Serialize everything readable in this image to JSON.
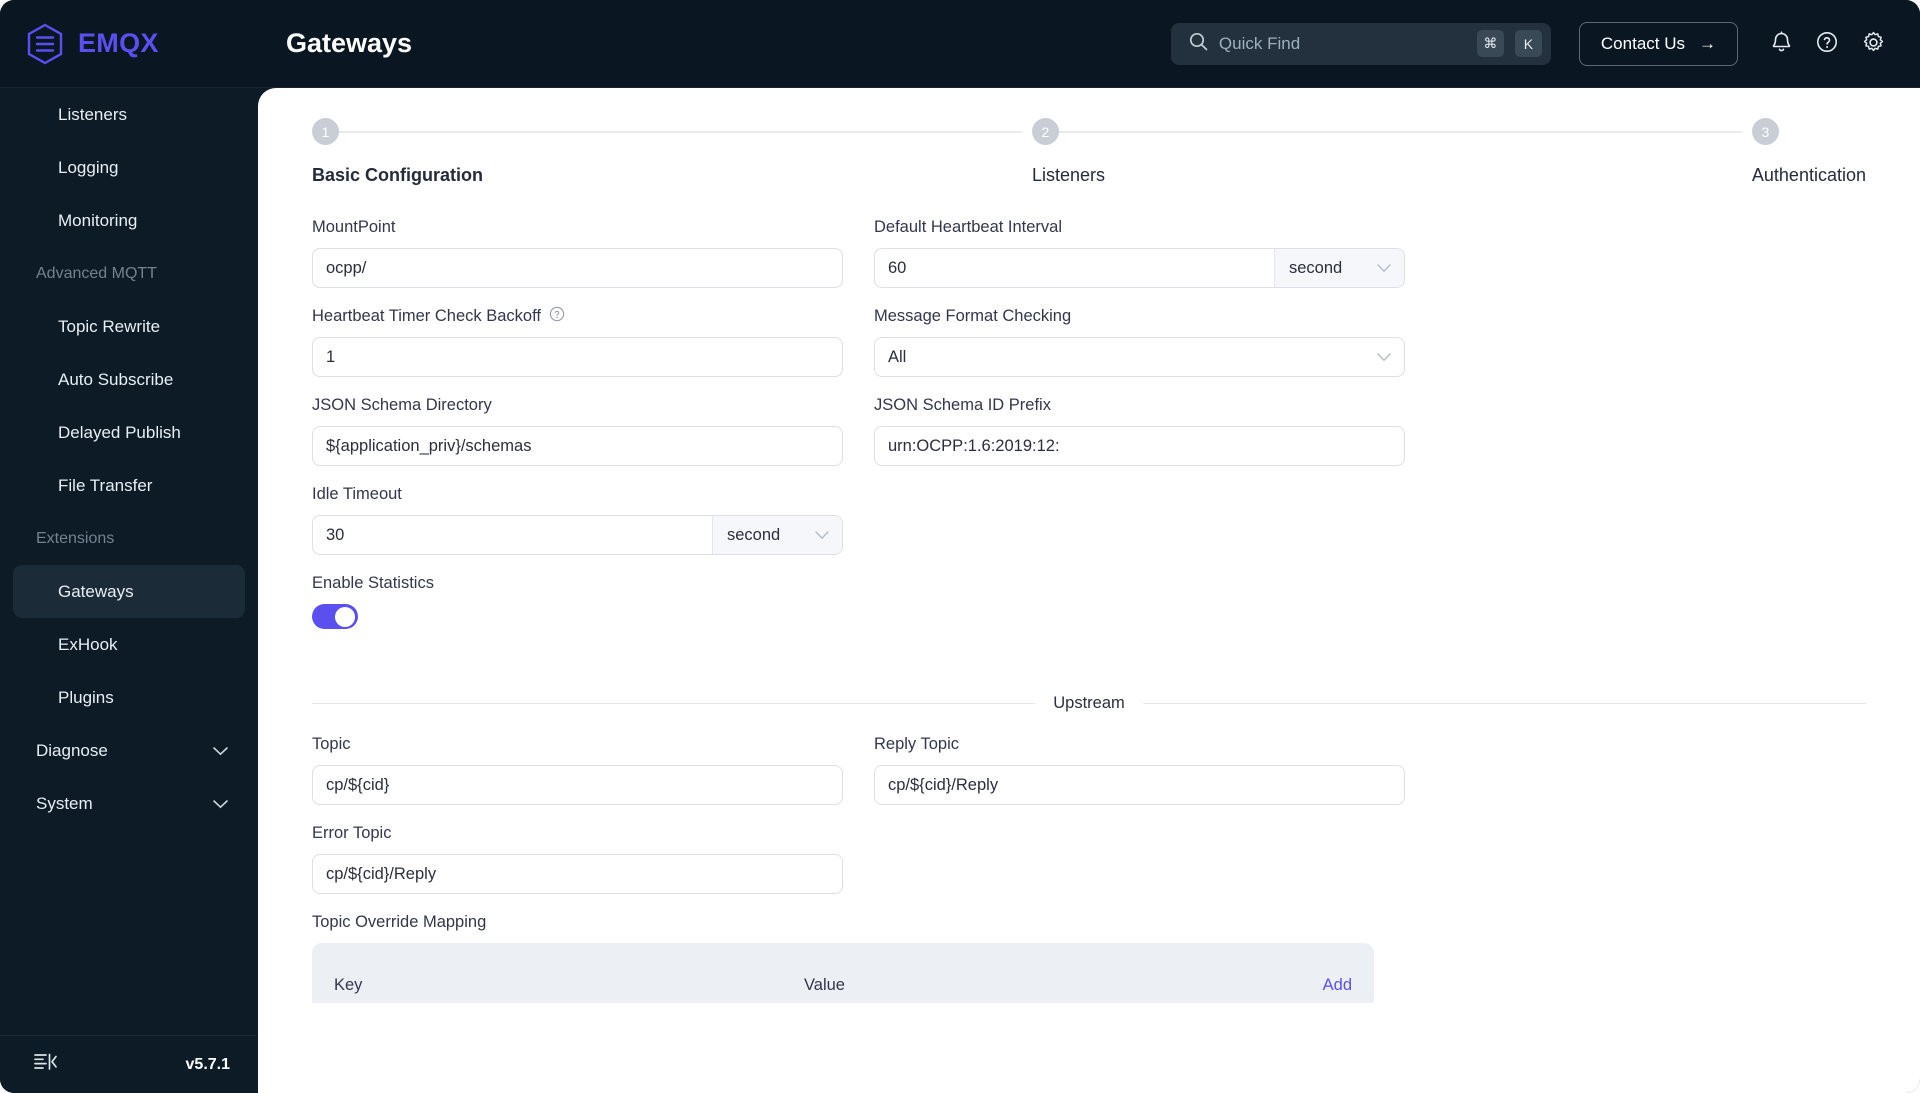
{
  "brand": {
    "name": "EMQX",
    "logo_icon": "emqx-hexagon-logo"
  },
  "header": {
    "page_title": "Gateways",
    "search": {
      "placeholder": "Quick Find",
      "value": "",
      "icon": "search-icon",
      "kbd_modifier": "⌘",
      "kbd_key": "K"
    },
    "contact_label": "Contact Us",
    "contact_arrow": "→",
    "icons": [
      "bell-icon",
      "help-circle-icon",
      "gear-icon"
    ]
  },
  "sidebar": {
    "items": [
      {
        "label": "Listeners",
        "type": "link",
        "active": false
      },
      {
        "label": "Logging",
        "type": "link",
        "active": false
      },
      {
        "label": "Monitoring",
        "type": "link",
        "active": false
      },
      {
        "label": "Advanced MQTT",
        "type": "group"
      },
      {
        "label": "Topic Rewrite",
        "type": "link",
        "active": false
      },
      {
        "label": "Auto Subscribe",
        "type": "link",
        "active": false
      },
      {
        "label": "Delayed Publish",
        "type": "link",
        "active": false
      },
      {
        "label": "File Transfer",
        "type": "link",
        "active": false
      },
      {
        "label": "Extensions",
        "type": "group"
      },
      {
        "label": "Gateways",
        "type": "link",
        "active": true
      },
      {
        "label": "ExHook",
        "type": "link",
        "active": false
      },
      {
        "label": "Plugins",
        "type": "link",
        "active": false
      },
      {
        "label": "Diagnose",
        "type": "collapsible",
        "active": false
      },
      {
        "label": "System",
        "type": "collapsible",
        "active": false
      }
    ],
    "footer": {
      "collapse_icon": "collapse-sidebar-icon",
      "version": "v5.7.1"
    }
  },
  "steps": [
    {
      "number": "1",
      "label": "Basic Configuration",
      "current": true
    },
    {
      "number": "2",
      "label": "Listeners",
      "current": false
    },
    {
      "number": "3",
      "label": "Authentication",
      "current": false
    }
  ],
  "form": {
    "mountpoint": {
      "label": "MountPoint",
      "value": "ocpp/"
    },
    "heartbeat_interval": {
      "label": "Default Heartbeat Interval",
      "value": "60",
      "unit": "second"
    },
    "heartbeat_backoff": {
      "label": "Heartbeat Timer Check Backoff",
      "value": "1",
      "has_help": true
    },
    "message_format_checking": {
      "label": "Message Format Checking",
      "value": "All"
    },
    "json_schema_dir": {
      "label": "JSON Schema Directory",
      "value": "${application_priv}/schemas"
    },
    "json_schema_id_prefix": {
      "label": "JSON Schema ID Prefix",
      "value": "urn:OCPP:1.6:2019:12:"
    },
    "idle_timeout": {
      "label": "Idle Timeout",
      "value": "30",
      "unit": "second"
    },
    "enable_statistics": {
      "label": "Enable Statistics",
      "enabled": true
    }
  },
  "upstream": {
    "section_title": "Upstream",
    "topic": {
      "label": "Topic",
      "value": "cp/${cid}"
    },
    "reply_topic": {
      "label": "Reply Topic",
      "value": "cp/${cid}/Reply"
    },
    "error_topic": {
      "label": "Error Topic",
      "value": "cp/${cid}/Reply"
    },
    "topic_override_mapping": {
      "label": "Topic Override Mapping",
      "columns": {
        "key": "Key",
        "value": "Value",
        "add": "Add"
      }
    }
  },
  "colors": {
    "accent": "#5b4ff0",
    "sidebar_bg": "#0d1b27",
    "topbar_bg": "#0a1722",
    "active_item": "#1c2b38"
  }
}
